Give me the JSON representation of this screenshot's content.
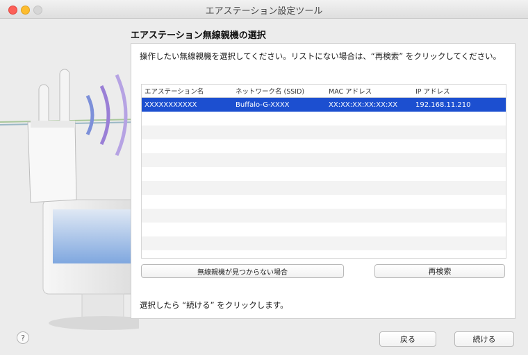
{
  "window": {
    "title": "エアステーション設定ツール"
  },
  "page": {
    "heading": "エアステーション無線親機の選択",
    "instruction": "操作したい無線親機を選択してください。リストにない場合は、“再検索” をクリックしてください。",
    "footnote": "選択したら “続ける” をクリックします。"
  },
  "table": {
    "columns": [
      "エアステーション名",
      "ネットワーク名 (SSID)",
      "MAC アドレス",
      "IP アドレス"
    ],
    "rows": [
      {
        "name": "XXXXXXXXXXX",
        "ssid": "Buffalo-G-XXXX",
        "mac": "XX:XX:XX:XX:XX:XX",
        "ip": "192.168.11.210",
        "selected": true
      }
    ]
  },
  "buttons": {
    "not_found": "無線親機が見つからない場合",
    "research": "再検索",
    "back": "戻る",
    "continue": "続ける",
    "help": "?"
  },
  "icons": {
    "help": "help-icon",
    "illustration": "router-illustration"
  }
}
